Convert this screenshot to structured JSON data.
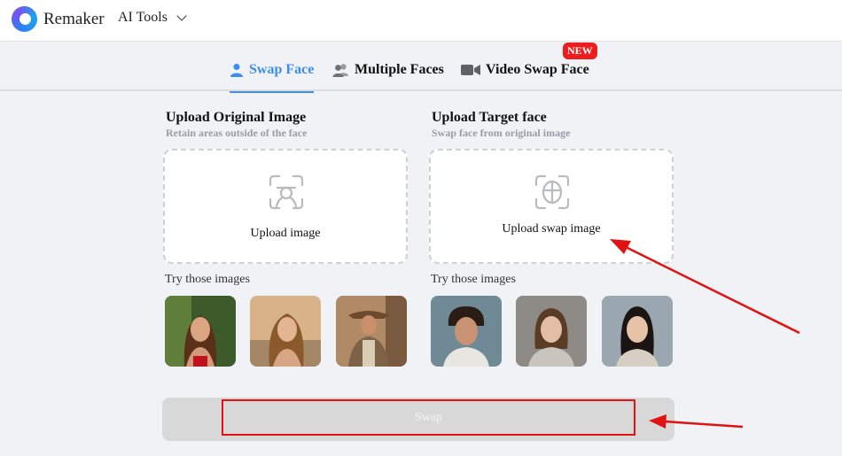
{
  "header": {
    "brand": "Remaker",
    "tools_menu": "AI Tools"
  },
  "tabs": [
    {
      "label": "Swap Face",
      "icon": "person-icon",
      "active": true
    },
    {
      "label": "Multiple Faces",
      "icon": "people-icon",
      "active": false
    },
    {
      "label": "Video Swap Face",
      "icon": "video-camera-icon",
      "active": false,
      "badge": "NEW"
    }
  ],
  "original": {
    "title": "Upload Original Image",
    "subtitle": "Retain areas outside of the face",
    "upload_label": "Upload image",
    "try_label": "Try those images",
    "samples": [
      "sample-woman-forest",
      "sample-woman-sunset",
      "sample-man-cowboy"
    ]
  },
  "target": {
    "title": "Upload Target face",
    "subtitle": "Swap face from original image",
    "upload_label": "Upload swap image",
    "try_label": "Try those images",
    "samples": [
      "sample-man-curly",
      "sample-woman-freckles",
      "sample-woman-asian"
    ]
  },
  "swap_button": "Swap",
  "colors": {
    "accent": "#3b8ef0",
    "badge": "#ee1c1c",
    "annotation": "#e01212"
  }
}
